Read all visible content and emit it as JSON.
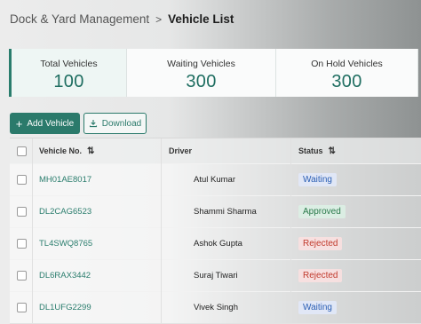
{
  "breadcrumb": {
    "parent": "Dock & Yard Management",
    "separator": ">",
    "current": "Vehicle List"
  },
  "stats": [
    {
      "label": "Total Vehicles",
      "value": "100"
    },
    {
      "label": "Waiting Vehicles",
      "value": "300"
    },
    {
      "label": "On Hold Vehicles",
      "value": "300"
    }
  ],
  "toolbar": {
    "add_label": "Add Vehicle",
    "add_icon": "plus-icon",
    "download_label": "Download",
    "download_icon": "download-icon"
  },
  "table": {
    "columns": [
      "Vehicle No.",
      "Driver",
      "Status"
    ],
    "sort_icon": "sort-icon",
    "rows": [
      {
        "vehicle": "MH01AE8017",
        "driver": "Atul Kumar",
        "status": "Waiting"
      },
      {
        "vehicle": "DL2CAG6523",
        "driver": "Shammi Sharma",
        "status": "Approved"
      },
      {
        "vehicle": "TL4SWQ8765",
        "driver": "Ashok Gupta",
        "status": "Rejected"
      },
      {
        "vehicle": "DL6RAX3442",
        "driver": "Suraj Tiwari",
        "status": "Rejected"
      },
      {
        "vehicle": "DL1UFG2299",
        "driver": "Vivek Singh",
        "status": "Waiting"
      }
    ]
  },
  "colors": {
    "accent": "#2b7a6b",
    "waiting": "#2b5fb4",
    "approved": "#2b7a4b",
    "rejected": "#c0392b"
  }
}
